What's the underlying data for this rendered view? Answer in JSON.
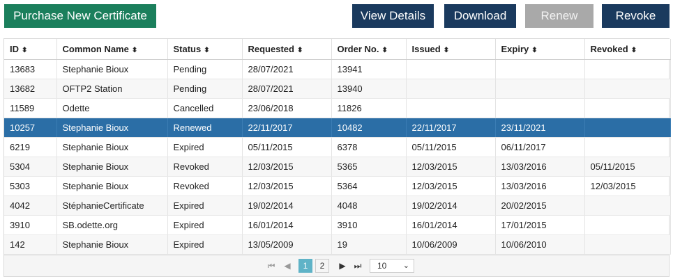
{
  "toolbar": {
    "purchase": "Purchase New Certificate",
    "view_details": "View Details",
    "download": "Download",
    "renew": "Renew",
    "revoke": "Revoke"
  },
  "table": {
    "headers": [
      "ID",
      "Common Name",
      "Status",
      "Requested",
      "Order No.",
      "Issued",
      "Expiry",
      "Revoked"
    ],
    "sort_icon": "⬍",
    "rows": [
      [
        "13683",
        "Stephanie Bioux",
        "Pending",
        "28/07/2021",
        "13941",
        "",
        "",
        ""
      ],
      [
        "13682",
        "OFTP2 Station",
        "Pending",
        "28/07/2021",
        "13940",
        "",
        "",
        ""
      ],
      [
        "11589",
        "Odette",
        "Cancelled",
        "23/06/2018",
        "11826",
        "",
        "",
        ""
      ],
      [
        "10257",
        "Stephanie Bioux",
        "Renewed",
        "22/11/2017",
        "10482",
        "22/11/2017",
        "23/11/2021",
        ""
      ],
      [
        "6219",
        "Stephanie Bioux",
        "Expired",
        "05/11/2015",
        "6378",
        "05/11/2015",
        "06/11/2017",
        ""
      ],
      [
        "5304",
        "Stephanie Bioux",
        "Revoked",
        "12/03/2015",
        "5365",
        "12/03/2015",
        "13/03/2016",
        "05/11/2015"
      ],
      [
        "5303",
        "Stephanie Bioux",
        "Revoked",
        "12/03/2015",
        "5364",
        "12/03/2015",
        "13/03/2016",
        "12/03/2015"
      ],
      [
        "4042",
        "StéphanieCertificate",
        "Expired",
        "19/02/2014",
        "4048",
        "19/02/2014",
        "20/02/2015",
        ""
      ],
      [
        "3910",
        "SB.odette.org",
        "Expired",
        "16/01/2014",
        "3910",
        "16/01/2014",
        "17/01/2015",
        ""
      ],
      [
        "142",
        "Stephanie Bioux",
        "Expired",
        "13/05/2009",
        "19",
        "10/06/2009",
        "10/06/2010",
        ""
      ]
    ],
    "selected_index": 3
  },
  "pager": {
    "first": "⏮",
    "prev": "◀",
    "page1": "1",
    "page2": "2",
    "next": "▶",
    "last": "⏭",
    "page_size": "10",
    "chevron": "⌄"
  }
}
